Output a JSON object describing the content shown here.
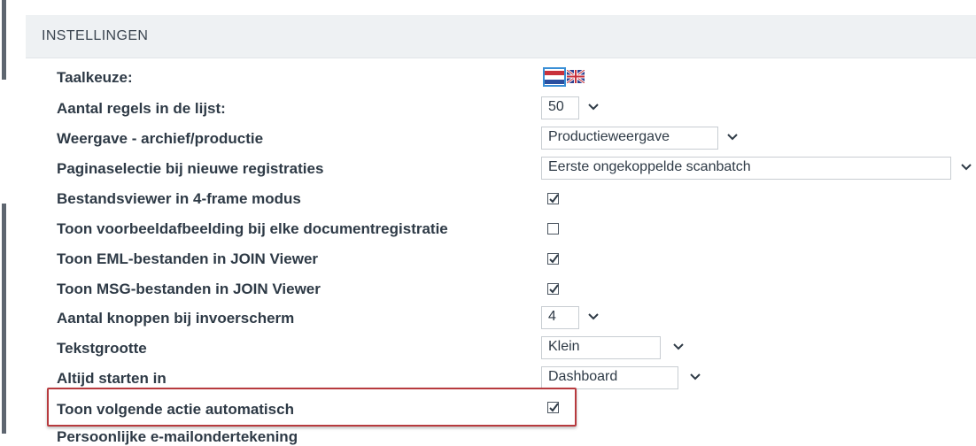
{
  "settings": {
    "title": "INSTELLINGEN",
    "rows": [
      {
        "label": "Taalkeuze:",
        "control": "flags"
      },
      {
        "label": "Aantal regels in de lijst:",
        "control": "select",
        "value": "50"
      },
      {
        "label": "Weergave - archief/productie",
        "control": "select",
        "value": "Productieweergave"
      },
      {
        "label": "Paginaselectie bij nieuwe registraties",
        "control": "select",
        "value": "Eerste ongekoppelde scanbatch"
      },
      {
        "label": "Bestandsviewer in 4-frame modus",
        "control": "checkbox",
        "checked": true
      },
      {
        "label": "Toon voorbeeldafbeelding bij elke documentregistratie",
        "control": "checkbox",
        "checked": false
      },
      {
        "label": "Toon EML-bestanden in JOIN Viewer",
        "control": "checkbox",
        "checked": true
      },
      {
        "label": "Toon MSG-bestanden in JOIN Viewer",
        "control": "checkbox",
        "checked": true
      },
      {
        "label": "Aantal knoppen bij invoerscherm",
        "control": "select",
        "value": "4"
      },
      {
        "label": "Tekstgrootte",
        "control": "select",
        "value": "Klein"
      },
      {
        "label": "Altijd starten in",
        "control": "select",
        "value": "Dashboard"
      },
      {
        "label": "Toon volgende actie automatisch",
        "control": "checkbox",
        "checked": true
      },
      {
        "label": "Persoonlijke e-mailondertekening",
        "control": "none"
      }
    ]
  },
  "colors": {
    "header_bg": "#eef1f3",
    "highlight_border": "#b73a3e",
    "label_text": "#2e3a46"
  },
  "icons": {
    "flag_nl": "dutch-flag-icon",
    "flag_uk": "uk-flag-icon",
    "chevron": "chevron-down-icon",
    "check": "checkmark-icon"
  }
}
